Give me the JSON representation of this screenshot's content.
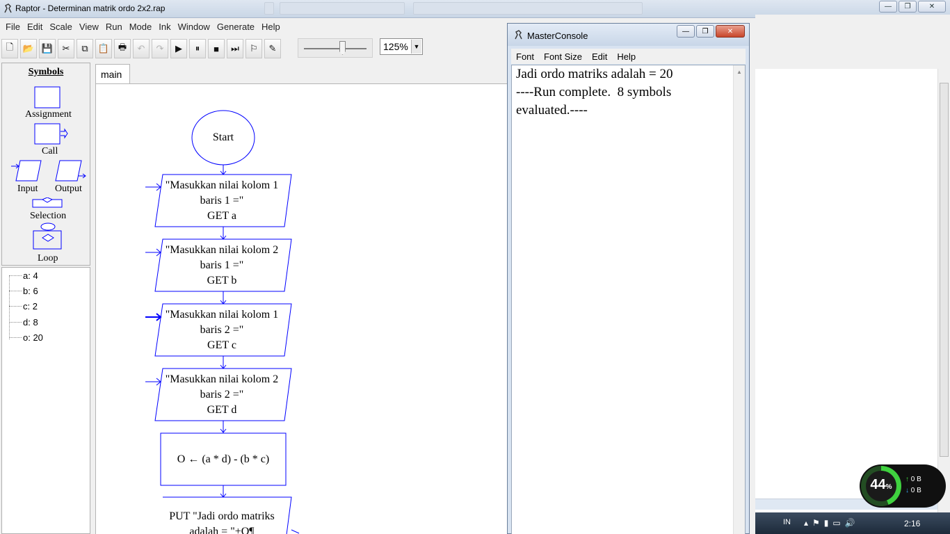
{
  "window": {
    "title": "Raptor - Determinan matrik ordo 2x2.rap",
    "minimize": "—",
    "maximize": "❐",
    "close": "✕"
  },
  "menu": [
    "File",
    "Edit",
    "Scale",
    "View",
    "Run",
    "Mode",
    "Ink",
    "Window",
    "Generate",
    "Help"
  ],
  "toolbar": {
    "buttons": [
      {
        "name": "new-icon",
        "glyph": "🗋"
      },
      {
        "name": "open-icon",
        "glyph": "📂"
      },
      {
        "name": "save-icon",
        "glyph": "💾"
      },
      {
        "name": "cut-icon",
        "glyph": "✂"
      },
      {
        "name": "copy-icon",
        "glyph": "⧉"
      },
      {
        "name": "paste-icon",
        "glyph": "📋"
      },
      {
        "name": "print-icon",
        "glyph": "🖶"
      },
      {
        "name": "undo-icon",
        "glyph": "↶"
      },
      {
        "name": "redo-icon",
        "glyph": "↷"
      },
      {
        "name": "execute-icon",
        "glyph": "▶"
      },
      {
        "name": "pause-icon",
        "glyph": "⏸"
      },
      {
        "name": "stop-icon",
        "glyph": "■"
      },
      {
        "name": "step-icon",
        "glyph": "⏭"
      },
      {
        "name": "test-icon",
        "glyph": "⚐"
      },
      {
        "name": "pen-icon",
        "glyph": "✎"
      }
    ],
    "zoom": "125%"
  },
  "symbols": {
    "heading": "Symbols",
    "assignment": "Assignment",
    "call": "Call",
    "input": "Input",
    "output": "Output",
    "selection": "Selection",
    "loop": "Loop"
  },
  "variables": [
    "a: 4",
    "b: 6",
    "c: 2",
    "d: 8",
    "o: 20"
  ],
  "tabs": {
    "main": "main"
  },
  "flowchart": {
    "start": "Start",
    "inputs": [
      {
        "prompt1": "\"Masukkan nilai kolom 1",
        "prompt2": "baris 1 =\"",
        "get": "GET a"
      },
      {
        "prompt1": "\"Masukkan nilai kolom 2",
        "prompt2": "baris 1 =\"",
        "get": "GET b"
      },
      {
        "prompt1": "\"Masukkan nilai kolom 1",
        "prompt2": "baris 2 =\"",
        "get": "GET c"
      },
      {
        "prompt1": "\"Masukkan nilai kolom 2",
        "prompt2": "baris 2 =\"",
        "get": "GET d"
      }
    ],
    "assignment": "O ← (a * d)  -  (b * c)",
    "output1": "PUT \"Jadi ordo matriks",
    "output2": "adalah = \"+O¶"
  },
  "console": {
    "title": "MasterConsole",
    "menu": [
      "Font",
      "Font Size",
      "Edit",
      "Help"
    ],
    "lines": [
      "Jadi ordo matriks adalah = 20",
      "----Run complete.  8 symbols",
      "evaluated.----"
    ]
  },
  "taskbar": {
    "lang": "IN",
    "time": "2:16"
  },
  "net_widget": {
    "percent": "44",
    "percent_sign": "%",
    "up": "0 B",
    "down": "0 B",
    "up_arrow": "↑",
    "down_arrow": "↓"
  }
}
